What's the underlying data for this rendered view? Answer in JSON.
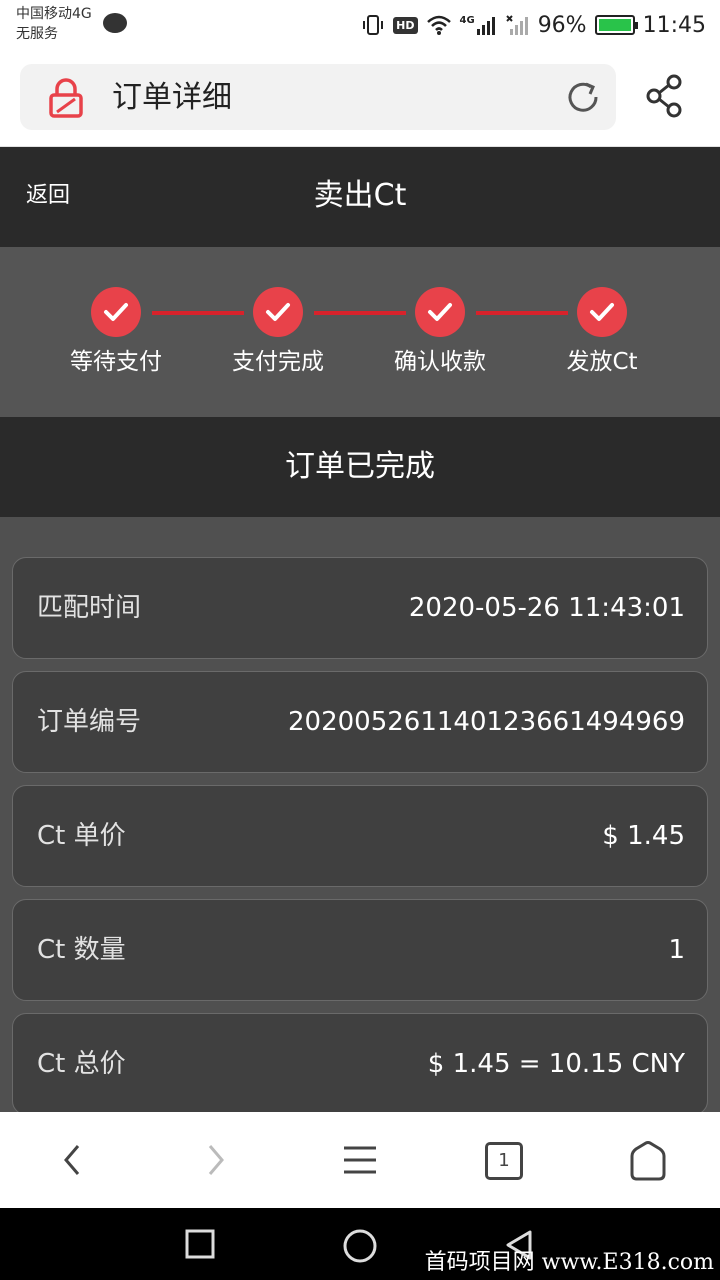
{
  "status_bar": {
    "carrier_line1": "中国移动4G",
    "carrier_line2": "无服务",
    "net": "4G",
    "battery": "96%",
    "time": "11:45",
    "hd": "HD"
  },
  "browser": {
    "page_title": "订单详细",
    "tab_count": "1"
  },
  "header": {
    "back_label": "返回",
    "title": "卖出Ct"
  },
  "steps": [
    {
      "label": "等待支付",
      "done": true
    },
    {
      "label": "支付完成",
      "done": true
    },
    {
      "label": "确认收款",
      "done": true
    },
    {
      "label": "发放Ct",
      "done": true
    }
  ],
  "order_status": "订单已完成",
  "details": [
    {
      "label": "匹配时间",
      "value": "2020-05-26 11:43:01"
    },
    {
      "label": "订单编号",
      "value": "2020052611401236614949​69"
    },
    {
      "label": "Ct 单价",
      "value": "$ 1.45"
    },
    {
      "label": "Ct 数量",
      "value": "1"
    },
    {
      "label": "Ct 总价",
      "value": "$ 1.45 = 10.15 CNY"
    }
  ],
  "watermark": "首码项目网 www.E318.com",
  "colors": {
    "accent_red": "#e8424a",
    "line_red": "#d8222b",
    "header_bg": "#2a2a2a",
    "panel_bg": "#555555"
  }
}
